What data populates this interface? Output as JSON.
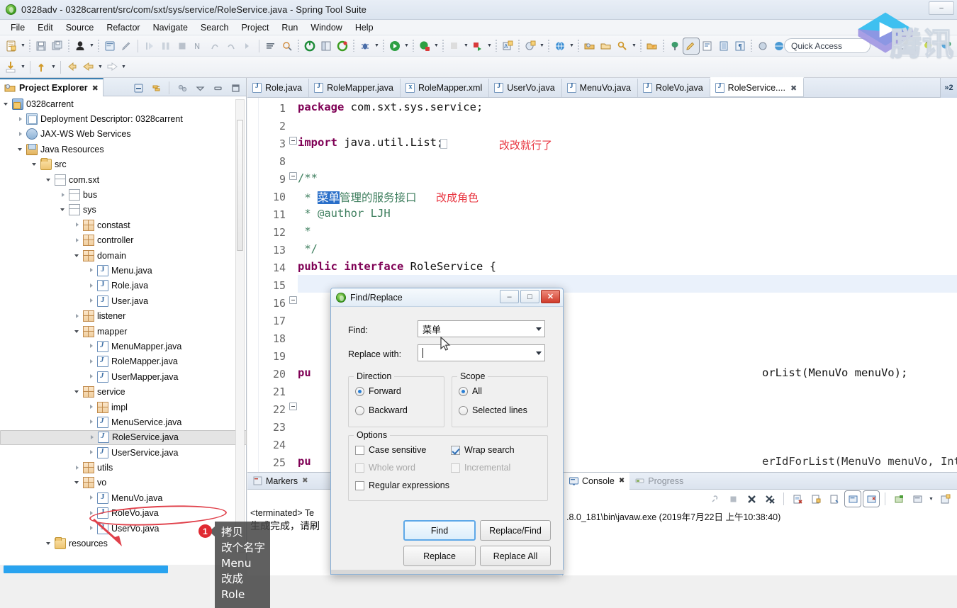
{
  "window": {
    "title": "0328adv - 0328carrent/src/com/sxt/sys/service/RoleService.java - Spring Tool Suite",
    "minimize": "–",
    "maximize": "□",
    "close": "✕"
  },
  "menubar": {
    "items": [
      "File",
      "Edit",
      "Source",
      "Refactor",
      "Navigate",
      "Search",
      "Project",
      "Run",
      "Window",
      "Help"
    ]
  },
  "quick_access": {
    "label": "Quick Access"
  },
  "watermark": {
    "text": "腾讯"
  },
  "project_explorer": {
    "tab_label": "Project Explorer",
    "close_glyph": "✖",
    "tools": [
      "collapse-all-icon",
      "link-editor-icon",
      "view-menu-icon",
      "minimize-icon",
      "maximize-icon"
    ],
    "tree": [
      {
        "label": "0328carrent",
        "indent": 0,
        "arrow": "open",
        "icon": "project"
      },
      {
        "label": "Deployment Descriptor: 0328carrent",
        "indent": 1,
        "arrow": "closed",
        "icon": "dd"
      },
      {
        "label": "JAX-WS Web Services",
        "indent": 1,
        "arrow": "closed",
        "icon": "ws"
      },
      {
        "label": "Java Resources",
        "indent": 1,
        "arrow": "open",
        "icon": "jr"
      },
      {
        "label": "src",
        "indent": 2,
        "arrow": "open",
        "icon": "folder"
      },
      {
        "label": "com.sxt",
        "indent": 3,
        "arrow": "open",
        "icon": "pkg"
      },
      {
        "label": "bus",
        "indent": 4,
        "arrow": "closed",
        "icon": "pkg"
      },
      {
        "label": "sys",
        "indent": 4,
        "arrow": "open",
        "icon": "pkg"
      },
      {
        "label": "constast",
        "indent": 5,
        "arrow": "closed",
        "icon": "pkg2"
      },
      {
        "label": "controller",
        "indent": 5,
        "arrow": "closed",
        "icon": "pkg2"
      },
      {
        "label": "domain",
        "indent": 5,
        "arrow": "open",
        "icon": "pkg2"
      },
      {
        "label": "Menu.java",
        "indent": 6,
        "arrow": "closed",
        "icon": "java"
      },
      {
        "label": "Role.java",
        "indent": 6,
        "arrow": "closed",
        "icon": "java"
      },
      {
        "label": "User.java",
        "indent": 6,
        "arrow": "closed",
        "icon": "java"
      },
      {
        "label": "listener",
        "indent": 5,
        "arrow": "closed",
        "icon": "pkg2"
      },
      {
        "label": "mapper",
        "indent": 5,
        "arrow": "open",
        "icon": "pkg2"
      },
      {
        "label": "MenuMapper.java",
        "indent": 6,
        "arrow": "closed",
        "icon": "jif"
      },
      {
        "label": "RoleMapper.java",
        "indent": 6,
        "arrow": "closed",
        "icon": "jif"
      },
      {
        "label": "UserMapper.java",
        "indent": 6,
        "arrow": "closed",
        "icon": "jif"
      },
      {
        "label": "service",
        "indent": 5,
        "arrow": "open",
        "icon": "pkg2"
      },
      {
        "label": "impl",
        "indent": 6,
        "arrow": "closed",
        "icon": "pkg2"
      },
      {
        "label": "MenuService.java",
        "indent": 6,
        "arrow": "closed",
        "icon": "jif"
      },
      {
        "label": "RoleService.java",
        "indent": 6,
        "arrow": "closed",
        "icon": "jif",
        "selected": true
      },
      {
        "label": "UserService.java",
        "indent": 6,
        "arrow": "closed",
        "icon": "jif"
      },
      {
        "label": "utils",
        "indent": 5,
        "arrow": "closed",
        "icon": "pkg2"
      },
      {
        "label": "vo",
        "indent": 5,
        "arrow": "open",
        "icon": "pkg2"
      },
      {
        "label": "MenuVo.java",
        "indent": 6,
        "arrow": "closed",
        "icon": "java"
      },
      {
        "label": "RoleVo.java",
        "indent": 6,
        "arrow": "closed",
        "icon": "java"
      },
      {
        "label": "UserVo.java",
        "indent": 6,
        "arrow": "closed",
        "icon": "java"
      },
      {
        "label": "resources",
        "indent": 3,
        "arrow": "open",
        "icon": "folder"
      }
    ]
  },
  "annotation": {
    "badge": "1",
    "lines": [
      "拷贝",
      "改个名字",
      "Menu",
      "改成",
      "Role"
    ]
  },
  "editor": {
    "tabs": [
      {
        "label": "Role.java",
        "kind": "java",
        "active": false
      },
      {
        "label": "RoleMapper.java",
        "kind": "java",
        "active": false
      },
      {
        "label": "RoleMapper.xml",
        "kind": "xml",
        "active": false
      },
      {
        "label": "UserVo.java",
        "kind": "java",
        "active": false
      },
      {
        "label": "MenuVo.java",
        "kind": "java",
        "active": false
      },
      {
        "label": "RoleVo.java",
        "kind": "java",
        "active": false
      },
      {
        "label": "RoleService....",
        "kind": "java",
        "active": true,
        "close": "✖"
      }
    ],
    "overflow_label": "»2",
    "line_numbers": [
      "1",
      "2",
      "3",
      "8",
      "9",
      "10",
      "11",
      "12",
      "13",
      "14",
      "15",
      "16",
      "17",
      "18",
      "19",
      "20",
      "21",
      "22",
      "23",
      "24",
      "25"
    ],
    "code": {
      "l1_kw": "package",
      "l1_rest": " com.sxt.sys.service;",
      "l3_kw": "import",
      "l3_rest": " java.util.List;",
      "l9": "/**",
      "l10_star": " * ",
      "l10_sel": "菜单",
      "l10_rest": "管理的服务接口",
      "l11": " * @author LJH",
      "l12": " *",
      "l13": " */",
      "l14_kw1": "public",
      "l14_kw2": "interface",
      "l14_name": " RoleService {",
      "l20_kw": "pu",
      "l20_tail": "orList(MenuVo menuVo);",
      "l25_kw": "pu",
      "l25_tail": "erIdForList(MenuVo menuVo, Integer userId);"
    },
    "annotations": [
      {
        "text": "改改就行了"
      },
      {
        "text": "改成角色"
      }
    ]
  },
  "bottom_views": {
    "markers": {
      "label": "Markers",
      "close": "✖"
    },
    "console": {
      "label": "Console",
      "close": "✖"
    },
    "progress": {
      "label": "Progress"
    },
    "markers_content": [
      "<terminated> Te",
      "生成完成，请刷"
    ],
    "console_content": [
      ".8.0_181\\bin\\javaw.exe (2019年7月22日 上午10:38:40)"
    ]
  },
  "dialog": {
    "title": "Find/Replace",
    "minimize": "–",
    "maximize": "□",
    "close": "✕",
    "find_label": "Find:",
    "find_value": "菜单",
    "replace_label": "Replace with:",
    "replace_value": "",
    "direction": {
      "legend": "Direction",
      "options": [
        {
          "label": "Forward",
          "selected": true
        },
        {
          "label": "Backward",
          "selected": false
        }
      ]
    },
    "scope": {
      "legend": "Scope",
      "options": [
        {
          "label": "All",
          "selected": true
        },
        {
          "label": "Selected lines",
          "selected": false
        }
      ]
    },
    "options": {
      "legend": "Options",
      "items": [
        {
          "label": "Case sensitive",
          "checked": false,
          "disabled": false
        },
        {
          "label": "Wrap search",
          "checked": true,
          "disabled": false
        },
        {
          "label": "Whole word",
          "checked": false,
          "disabled": true
        },
        {
          "label": "Incremental",
          "checked": false,
          "disabled": true
        },
        {
          "label": "Regular expressions",
          "checked": false,
          "disabled": false
        }
      ]
    },
    "buttons": {
      "find": "Find",
      "replace_find": "Replace/Find",
      "replace": "Replace",
      "replace_all": "Replace All"
    }
  }
}
